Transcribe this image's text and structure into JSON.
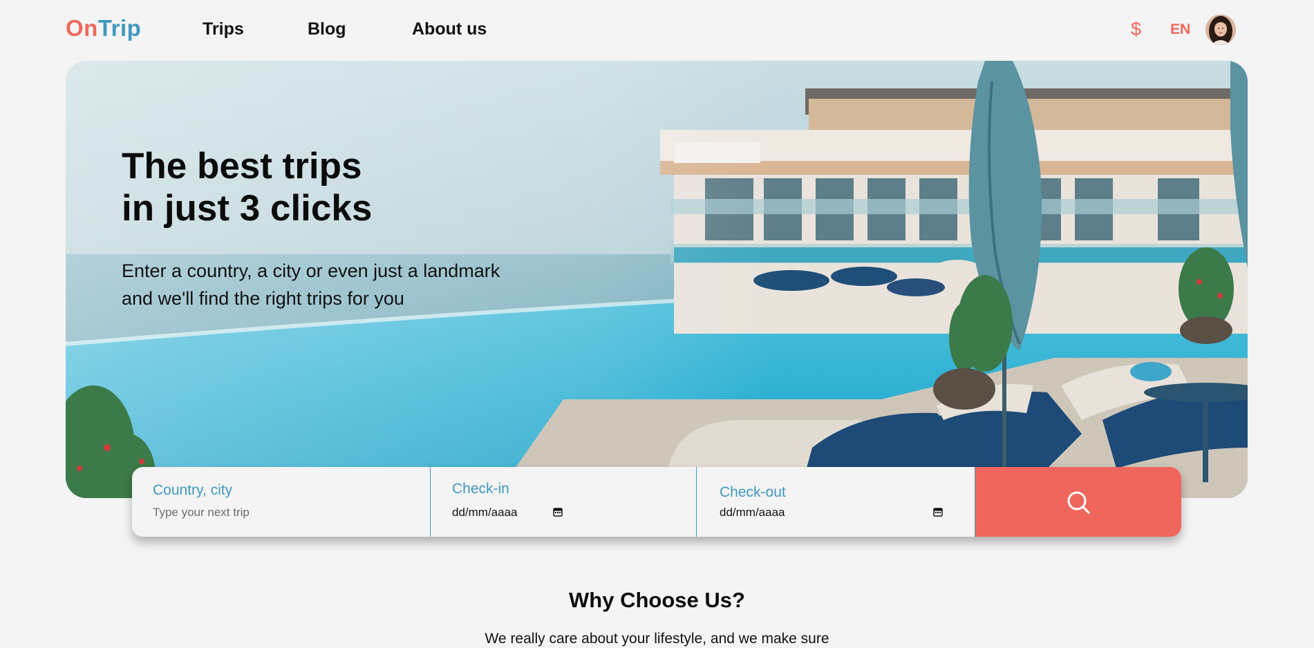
{
  "header": {
    "logo": {
      "part1": "On",
      "part2": "Trip"
    },
    "nav": [
      {
        "label": "Trips"
      },
      {
        "label": "Blog"
      },
      {
        "label": "About us"
      }
    ],
    "currency_symbol": "$",
    "language": "EN"
  },
  "hero": {
    "title_lines": [
      "The best trips",
      "in just 3 clicks"
    ],
    "subtitle_lines": [
      "Enter a country, a city or even just a landmark",
      "and we'll find the right trips for you"
    ]
  },
  "search": {
    "destination": {
      "label": "Country, city",
      "placeholder": "Type your next trip"
    },
    "checkin": {
      "label": "Check-in",
      "value": "dd/mm/aaaa"
    },
    "checkout": {
      "label": "Check-out",
      "value": "dd/mm/aaaa"
    }
  },
  "why": {
    "title": "Why Choose Us?",
    "text": "We really care about your lifestyle, and we make sure"
  },
  "colors": {
    "brand_coral": "#ef675c",
    "brand_blue": "#3f98bd",
    "background": "#f4f4f4"
  },
  "icons": {
    "currency": "dollar-icon",
    "search": "search-icon",
    "calendar": "calendar-icon"
  }
}
